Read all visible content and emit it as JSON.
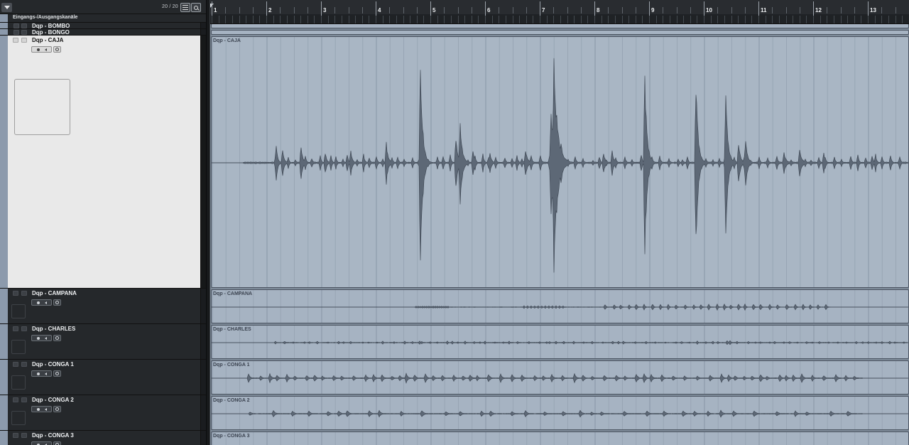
{
  "header": {
    "menu_icon": "chevron-down-icon",
    "track_count": "20 / 20",
    "list_icon": "list-icon",
    "search_icon": "search-icon"
  },
  "io_label": "Eingangs-/Ausgangskanäle",
  "tracks": {
    "bombo": {
      "name": "Dqp - BOMBO"
    },
    "bongo": {
      "name": "Dqp - BONGO"
    },
    "caja": {
      "name": "Dqp - CAJA"
    },
    "campana": {
      "name": "Dqp - CAMPANA"
    },
    "charles": {
      "name": "Dqp - CHARLES"
    },
    "conga1": {
      "name": "Dqp - CONGA 1"
    },
    "conga2": {
      "name": "Dqp - CONGA 2"
    },
    "conga3": {
      "name": "Dqp - CONGA 3"
    }
  },
  "events": {
    "caja": "Dqp - CAJA",
    "campana": "Dqp - CAMPANA",
    "charles": "Dqp - CHARLES",
    "conga1": "Dqp - CONGA 1",
    "conga2": "Dqp - CONGA 2",
    "conga3": "Dqp - CONGA 3"
  },
  "ruler": {
    "bars": [
      "1",
      "2",
      "3",
      "4",
      "5",
      "6",
      "7",
      "8",
      "9",
      "10",
      "11",
      "12",
      "13"
    ]
  },
  "colors": {
    "selected_event": "#a9b6c4",
    "event": "#a6b3c2",
    "waveform": "#3b4450",
    "selected_track_bg": "#e9e9e9",
    "track_bg": "#25282b",
    "gutter": "#8c9aac"
  }
}
